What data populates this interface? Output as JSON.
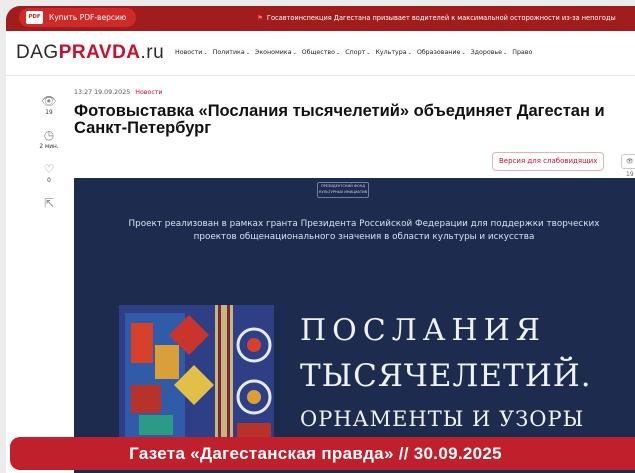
{
  "topbar": {
    "pdf_icon_text": "PDF",
    "pdf_button": "Купить PDF-версию",
    "ticker": "Госавтоинспекция Дагестана призывает водителей к максимальной осторожности из-за непогоды"
  },
  "header": {
    "logo_part1": "DAG",
    "logo_part2": "PRAVDA",
    "logo_part3": ".ru",
    "nav": [
      "Новости",
      "Политика",
      "Экономика",
      "Общество",
      "Спорт",
      "Культура",
      "Образование",
      "Здоровье",
      "Право"
    ]
  },
  "sidebar": {
    "views_icon": "eye-icon",
    "views": "19",
    "read_time_icon": "clock-icon",
    "read_time": "2 мин.",
    "likes_icon": "heart-icon",
    "likes": "0",
    "share_icon": "share-icon"
  },
  "article": {
    "timestamp": "13:27 19.09.2025",
    "category": "Новости",
    "title": "Фотовыставка «Послания тысячелетий» объединяет Дагестан и Санкт-Петербург",
    "vision_button": "Версия для слабовидящих",
    "views_pill": "19"
  },
  "hero": {
    "logo_text": "ПРЕЗИДЕНТСКИЙ ФОНД КУЛЬТУРНЫХ ИНИЦИАТИВ",
    "project_text": "Проект реализован в рамках гранта Президента Российской Федерации для поддержки творческих проектов общенационального значения в области культуры и искусства",
    "title_line1": "ПОСЛАНИЯ",
    "title_line2": "ТЫСЯЧЕЛЕТИЙ.",
    "subtitle": "ОРНАМЕНТЫ И УЗОРЫ"
  },
  "banner": {
    "text": "Газета «Дагестанская правда» // 30.09.2025"
  },
  "colors": {
    "brand_red": "#c8102e",
    "topbar": "#a11d1d",
    "banner": "#c0202b",
    "hero_bg": "#1c2b4e"
  }
}
